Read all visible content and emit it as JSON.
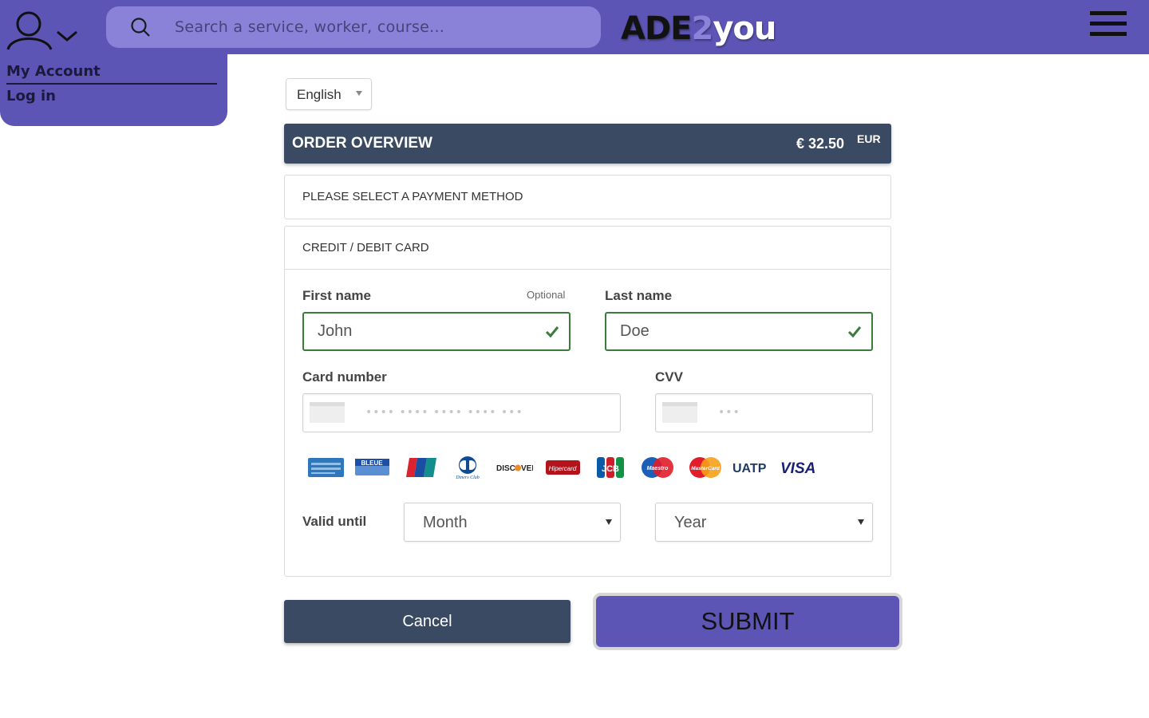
{
  "header": {
    "search_placeholder": "Search a service, worker, course...",
    "logo": {
      "part1": "ADE",
      "part2": "2",
      "part3": "you"
    }
  },
  "account_menu": {
    "items": [
      {
        "label": "My Account"
      },
      {
        "label": "Log in"
      }
    ]
  },
  "payment": {
    "language": "English",
    "overview": {
      "title": "ORDER OVERVIEW",
      "amount": "€ 32.50",
      "currency": "EUR"
    },
    "select_method": "PLEASE SELECT A PAYMENT METHOD",
    "card_title": "CREDIT / DEBIT CARD",
    "first_name": {
      "label": "First name",
      "optional": "Optional",
      "value": "John"
    },
    "last_name": {
      "label": "Last name",
      "value": "Doe"
    },
    "card_number": {
      "label": "Card number",
      "placeholder": "•••• •••• •••• •••• •••"
    },
    "cvv": {
      "label": "CVV",
      "placeholder": "•••"
    },
    "brands": [
      "American Express",
      "Bleue",
      "UnionPay",
      "Diners Club",
      "Discover",
      "Hipercard",
      "JCB",
      "Maestro",
      "MasterCard",
      "UATP",
      "VISA"
    ],
    "valid_until": {
      "label": "Valid until",
      "month": "Month",
      "year": "Year"
    },
    "cancel_label": "Cancel",
    "submit_label": "SUBMIT"
  },
  "colors": {
    "brand": "#5d55b6",
    "search_bg": "#8a82d8",
    "panel_dark": "#3a4a62",
    "valid": "#3a7d3a"
  },
  "icons": [
    "user-icon",
    "chevron-down-icon",
    "search-icon",
    "hamburger-menu-icon",
    "checkmark-icon",
    "card-icon"
  ]
}
